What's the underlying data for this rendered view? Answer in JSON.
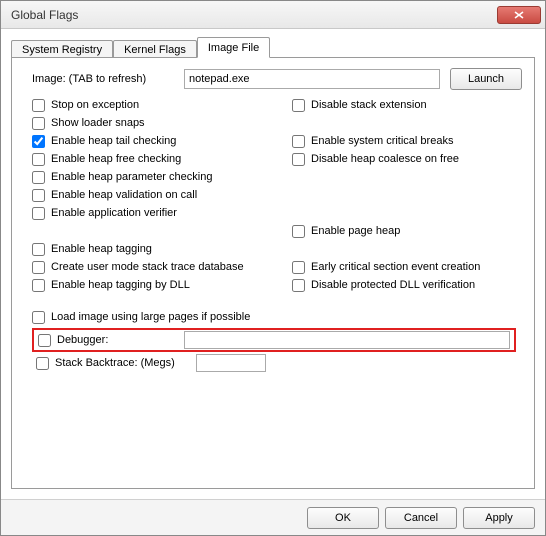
{
  "window": {
    "title": "Global Flags"
  },
  "tabs": [
    "System Registry",
    "Kernel Flags",
    "Image File"
  ],
  "activeTab": 2,
  "image": {
    "label": "Image: (TAB to refresh)",
    "value": "notepad.exe",
    "launch": "Launch"
  },
  "opts": {
    "stop_on_exception": "Stop on exception",
    "show_loader_snaps": "Show loader snaps",
    "disable_stack_extension": "Disable stack extension",
    "enable_heap_tail_checking": "Enable heap tail checking",
    "enable_heap_free_checking": "Enable heap free checking",
    "enable_heap_parameter_checking": "Enable heap parameter checking",
    "enable_heap_validation_on_call": "Enable heap validation on call",
    "enable_system_critical_breaks": "Enable system critical breaks",
    "disable_heap_coalesce_on_free": "Disable heap coalesce on free",
    "enable_application_verifier": "Enable application verifier",
    "enable_page_heap": "Enable page heap",
    "enable_heap_tagging": "Enable heap tagging",
    "create_user_mode_stack_trace_db": "Create user mode stack trace database",
    "early_critical_section_event_creation": "Early critical section event creation",
    "enable_heap_tagging_by_dll": "Enable heap tagging by DLL",
    "disable_protected_dll_verification": "Disable protected DLL verification",
    "load_image_using_large_pages": "Load image using large pages if possible",
    "debugger": "Debugger:",
    "stack_backtrace": "Stack Backtrace: (Megs)"
  },
  "checked": {
    "enable_heap_tail_checking": true
  },
  "debugger_value": "",
  "stack_backtrace_value": "",
  "buttons": {
    "ok": "OK",
    "cancel": "Cancel",
    "apply": "Apply"
  }
}
